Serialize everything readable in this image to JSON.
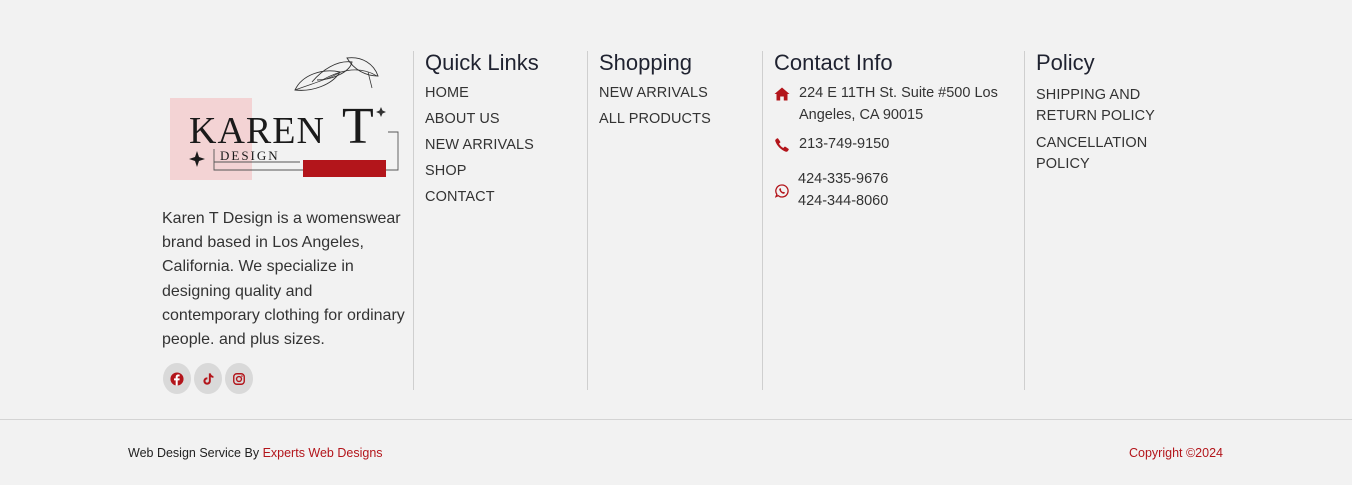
{
  "brand": {
    "logo_text": "KARENT",
    "logo_sub": "DESIGN",
    "description": "Karen T Design is a womenswear brand based in Los Angeles, California. We specialize in designing quality and contemporary clothing for ordinary people. and plus sizes.",
    "socials": [
      {
        "icon": "facebook-icon"
      },
      {
        "icon": "tiktok-icon"
      },
      {
        "icon": "instagram-icon"
      }
    ]
  },
  "quick_links": {
    "title": "Quick Links",
    "items": [
      "HOME",
      "ABOUT US",
      "NEW ARRIVALS",
      "SHOP",
      "CONTACT"
    ]
  },
  "shopping": {
    "title": "Shopping",
    "items": [
      "NEW ARRIVALS",
      "ALL PRODUCTS"
    ]
  },
  "contact": {
    "title": "Contact Info",
    "address": "224 E 11TH St. Suite #500 Los Angeles, CA 90015",
    "phone": "213-749-9150",
    "whatsapp_1": "424-335-9676",
    "whatsapp_2": "424-344-8060"
  },
  "policy": {
    "title": "Policy",
    "items": [
      "SHIPPING AND RETURN POLICY",
      "CANCELLATION POLICY"
    ]
  },
  "bottom": {
    "credit_prefix": "Web Design Service By",
    "credit_link": "Experts Web Designs",
    "copyright": "Copyright ©2024"
  },
  "colors": {
    "accent": "#b3151b",
    "background": "#f2f2f2",
    "logo_block": "#f3d3d4"
  }
}
